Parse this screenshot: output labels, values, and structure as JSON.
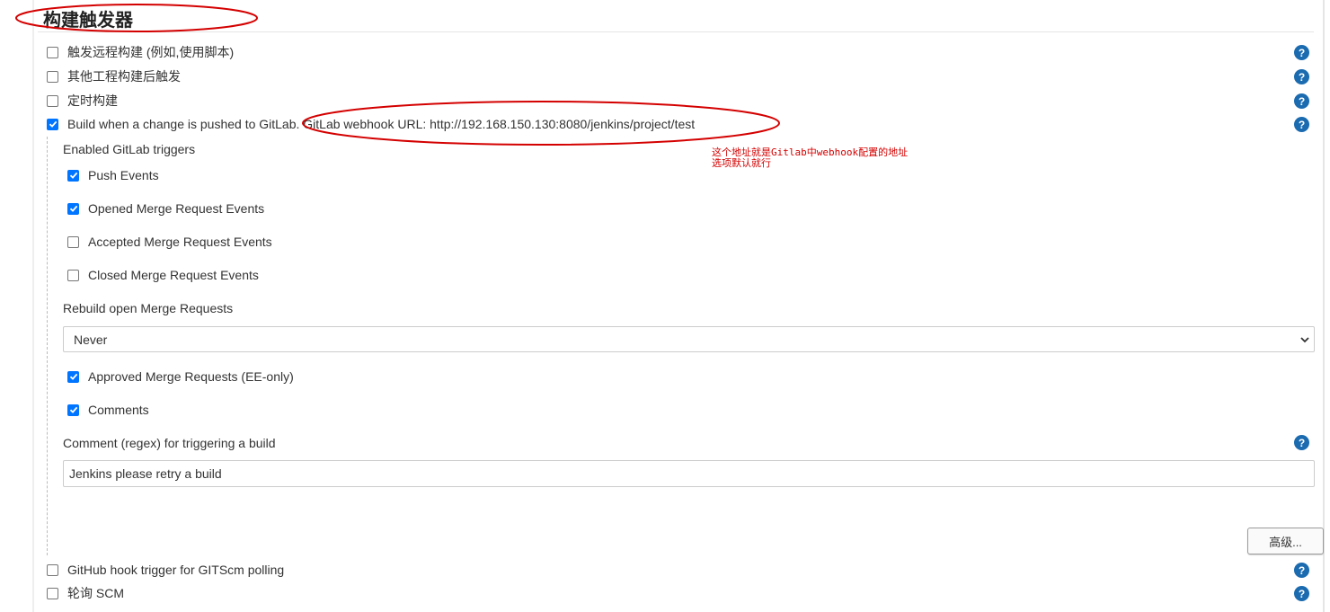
{
  "section_title": "构建触发器",
  "triggers": [
    {
      "label": "触发远程构建 (例如,使用脚本)",
      "checked": false
    },
    {
      "label": "其他工程构建后触发",
      "checked": false
    },
    {
      "label": "定时构建",
      "checked": false
    },
    {
      "label": "Build when a change is pushed to GitLab. GitLab webhook URL: http://192.168.150.130:8080/jenkins/project/test",
      "checked": true
    }
  ],
  "gitlab": {
    "enabled_triggers_label": "Enabled GitLab triggers",
    "events": [
      {
        "label": "Push Events",
        "checked": true
      },
      {
        "label": "Opened Merge Request Events",
        "checked": true
      },
      {
        "label": "Accepted Merge Request Events",
        "checked": false
      },
      {
        "label": "Closed Merge Request Events",
        "checked": false
      }
    ],
    "rebuild_label": "Rebuild open Merge Requests",
    "rebuild_value": "Never",
    "extra": [
      {
        "label": "Approved Merge Requests (EE-only)",
        "checked": true
      },
      {
        "label": "Comments",
        "checked": true
      }
    ],
    "comment_regex_label": "Comment (regex) for triggering a build",
    "comment_regex_value": "Jenkins please retry a build",
    "advanced_button": "高级..."
  },
  "bottom_triggers": [
    {
      "label": "GitHub hook trigger for GITScm polling",
      "checked": false
    },
    {
      "label": "轮询 SCM",
      "checked": false
    }
  ],
  "annotation": {
    "line1": "这个地址就是Gitlab中webhook配置的地址",
    "line2": "选项默认就行"
  },
  "colors": {
    "help_icon": "#1b6bb0",
    "checkbox_checked": "#0075ff",
    "annotation": "#d40000"
  }
}
